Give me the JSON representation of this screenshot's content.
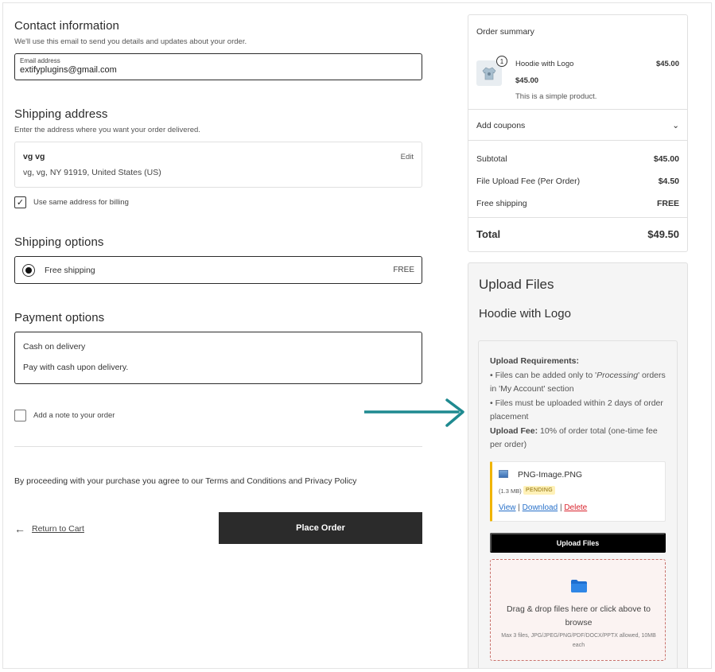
{
  "contact": {
    "title": "Contact information",
    "subtitle": "We'll use this email to send you details and updates about your order.",
    "email_label": "Email address",
    "email_value": "extifyplugins@gmail.com"
  },
  "shipping_address": {
    "title": "Shipping address",
    "subtitle": "Enter the address where you want your order delivered.",
    "name": "vg vg",
    "address": "vg, vg, NY 91919, United States (US)",
    "edit_label": "Edit",
    "same_billing_label": "Use same address for billing",
    "same_billing_checked": true
  },
  "shipping_options": {
    "title": "Shipping options",
    "option_label": "Free shipping",
    "option_price": "FREE"
  },
  "payment": {
    "title": "Payment options",
    "method": "Cash on delivery",
    "description": "Pay with cash upon delivery."
  },
  "note": {
    "label": "Add a note to your order"
  },
  "terms": "By proceeding with your purchase you agree to our Terms and Conditions and Privacy Policy",
  "actions": {
    "return_arrow": "←",
    "return_label": "Return to Cart",
    "place_order": "Place Order"
  },
  "summary": {
    "title": "Order summary",
    "product": {
      "qty": "1",
      "name": "Hoodie with Logo",
      "line_total": "$45.00",
      "price": "$45.00",
      "description": "This is a simple product."
    },
    "coupons_label": "Add coupons",
    "coupons_chevron": "⌄",
    "rows": [
      {
        "label": "Subtotal",
        "value": "$45.00"
      },
      {
        "label": "File Upload Fee (Per Order)",
        "value": "$4.50"
      },
      {
        "label": "Free shipping",
        "value": "FREE"
      }
    ],
    "total_label": "Total",
    "total_value": "$49.50"
  },
  "upload": {
    "title": "Upload Files",
    "product": "Hoodie with Logo",
    "req_heading": "Upload Requirements:",
    "req_1a": "• Files can be added only to '",
    "req_1b": "Processing",
    "req_1c": "' orders in 'My Account' section",
    "req_2": "• Files must be uploaded within 2 days of order placement",
    "fee_label": "Upload Fee:",
    "fee_text": " 10% of order total (one-time fee per order)",
    "file": {
      "name": "PNG-Image.PNG",
      "size": "(1.3 MB)",
      "status": "PENDING",
      "view": "View",
      "download": "Download",
      "delete": "Delete",
      "sep": "|"
    },
    "button": "Upload Files",
    "drop_text": "Drag & drop files here or click above to browse",
    "drop_sub": "Max 3 files, JPG/JPEG/PNG/PDF/DOCX/PPTX allowed, 10MB each"
  },
  "colors": {
    "accent_dark": "#2b2b2b",
    "arrow_teal": "#1f8a90",
    "pending_bg": "#fff1b8",
    "delete_red": "#d9232d",
    "link_blue": "#2770c9"
  },
  "icons": [
    "check-icon",
    "radio-selected-icon",
    "left-arrow-icon",
    "hoodie-thumbnail",
    "chevron-down-icon",
    "image-file-icon",
    "folder-icon",
    "teal-arrow-icon"
  ]
}
